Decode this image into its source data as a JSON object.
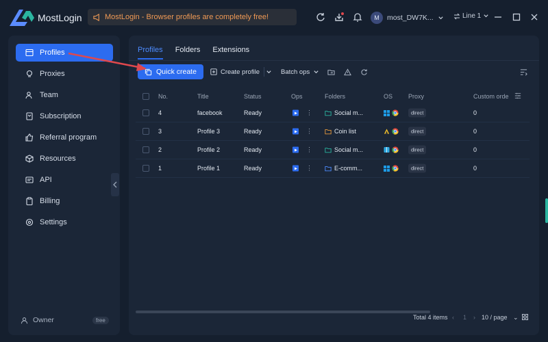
{
  "app": {
    "title": "MostLogin"
  },
  "notice": {
    "text": "MostLogin - Browser profiles are completely free!"
  },
  "account": {
    "avatar_letter": "M",
    "username": "most_DW7K..."
  },
  "line": {
    "label": "Line 1"
  },
  "sidebar": {
    "items": [
      {
        "label": "Profiles",
        "icon": "profiles-icon",
        "active": true
      },
      {
        "label": "Proxies",
        "icon": "proxy-icon"
      },
      {
        "label": "Team",
        "icon": "team-icon"
      },
      {
        "label": "Subscription",
        "icon": "subscription-icon"
      },
      {
        "label": "Referral program",
        "icon": "thumb-up-icon"
      },
      {
        "label": "Resources",
        "icon": "cube-icon"
      },
      {
        "label": "API",
        "icon": "api-icon"
      },
      {
        "label": "Billing",
        "icon": "clipboard-icon"
      },
      {
        "label": "Settings",
        "icon": "gear-icon"
      }
    ],
    "owner_label": "Owner",
    "plan_badge": "free"
  },
  "tabs": [
    {
      "label": "Profiles",
      "active": true
    },
    {
      "label": "Folders"
    },
    {
      "label": "Extensions"
    }
  ],
  "toolbar": {
    "quick_create": "Quick create",
    "create_profile": "Create profile",
    "batch_ops": "Batch ops"
  },
  "table": {
    "columns": [
      "No.",
      "Title",
      "Status",
      "Ops",
      "Folders",
      "OS",
      "Proxy",
      "Custom orde"
    ],
    "rows": [
      {
        "no": "4",
        "title": "facebook",
        "status": "Ready",
        "folder": "Social m...",
        "folder_color": "#2bb5a0",
        "os": "windows",
        "proxy": "direct"
      },
      {
        "no": "3",
        "title": "Profile 3",
        "status": "Ready",
        "folder": "Coin list",
        "folder_color": "#e89a3c",
        "os": "linux",
        "proxy": "direct"
      },
      {
        "no": "2",
        "title": "Profile 2",
        "status": "Ready",
        "folder": "Social m...",
        "folder_color": "#2bb5a0",
        "os": "mac",
        "proxy": "direct"
      },
      {
        "no": "1",
        "title": "Profile 1",
        "status": "Ready",
        "folder": "E-comm...",
        "folder_color": "#4d8cff",
        "os": "windows",
        "proxy": "direct"
      }
    ],
    "custom_order": [
      "0",
      "0",
      "0",
      "0"
    ]
  },
  "pagination": {
    "total": "Total 4 items",
    "current_page": "1",
    "page_size": "10 / page"
  },
  "colors": {
    "accent": "#2c6cf0",
    "notice": "#f09a55",
    "background": "#151f2e",
    "panel": "#1b2637",
    "annotation_arrow": "#e0484d"
  }
}
